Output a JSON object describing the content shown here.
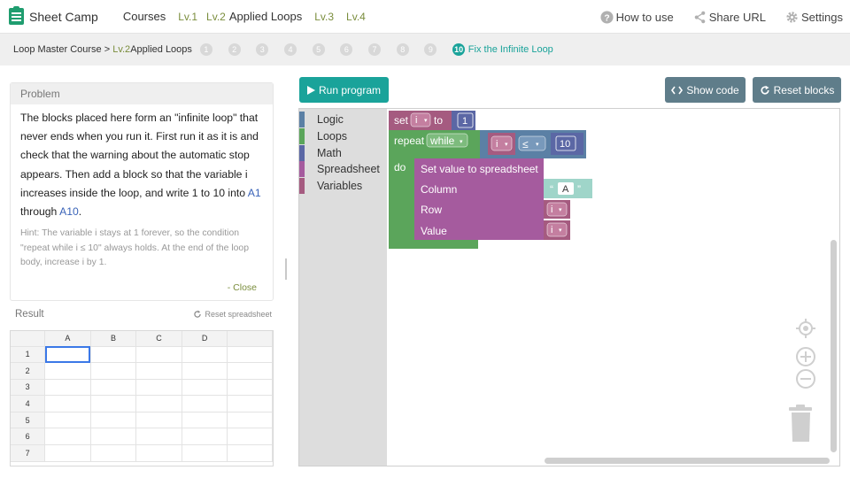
{
  "header": {
    "app_name": "Sheet Camp",
    "nav": {
      "courses": "Courses",
      "lv1": "Lv.1",
      "lv2": "Lv.2",
      "applied_loops": "Applied Loops",
      "lv3": "Lv.3",
      "lv4": "Lv.4"
    },
    "how_to_use": "How to use",
    "share_url": "Share URL",
    "settings": "Settings"
  },
  "breadcrumb": {
    "course": "Loop Master Course > ",
    "level": "Lv.2",
    "level_name": "Applied Loops",
    "steps": [
      "1",
      "2",
      "3",
      "4",
      "5",
      "6",
      "7",
      "8",
      "9"
    ],
    "current_step": "10",
    "current_step_label": "Fix the Infinite Loop"
  },
  "problem": {
    "heading": "Problem",
    "text_1": "The blocks placed here form an \"infinite loop\" that never ends when you run it. First run it as it is and check that the warning about the automatic stop appears. Then add a block so that the variable i increases inside the loop, and write 1 to 10 into ",
    "cell_a1": "A1",
    "text_2": " through ",
    "cell_a10": "A10",
    "text_3": ".",
    "hint": "Hint: The variable i stays at 1 forever, so the condition \"repeat while i ≤ 10\" always holds. At the end of the loop body, increase i by 1.",
    "close": "- Close"
  },
  "result": {
    "title": "Result",
    "reset_spreadsheet": "Reset spreadsheet",
    "columns": [
      "A",
      "B",
      "C",
      "D"
    ],
    "rows": [
      "1",
      "2",
      "3",
      "4",
      "5",
      "6",
      "7"
    ]
  },
  "toolbar": {
    "run_program": "Run program",
    "show_code": "Show code",
    "reset_blocks": "Reset blocks"
  },
  "toolbox": {
    "categories": [
      {
        "label": "Logic",
        "color": "#5b80a5"
      },
      {
        "label": "Loops",
        "color": "#5ba55b"
      },
      {
        "label": "Math",
        "color": "#5b67a5"
      },
      {
        "label": "Spreadsheet",
        "color": "#a55b9e"
      },
      {
        "label": "Variables",
        "color": "#a55b80"
      }
    ]
  },
  "blocks": {
    "set": "set",
    "var_i": "i",
    "to": "to",
    "init_value": "1",
    "repeat": "repeat",
    "while": "while",
    "compare_op": "≤",
    "limit": "10",
    "do": "do",
    "set_spreadsheet": "Set value to spreadsheet",
    "column": "Column",
    "column_value": "A",
    "row": "Row",
    "value": "Value",
    "colors": {
      "variable": "#a55b80",
      "loop": "#5ba55b",
      "logic": "#5b80a5",
      "math": "#5b67a5",
      "spreadsheet": "#a55b9e",
      "text": "#9fd5c9"
    }
  },
  "icons": {
    "logo": "sheet-logo-icon",
    "help": "question-circle-icon",
    "share": "share-icon",
    "settings": "gear-icon",
    "play": "play-icon",
    "code": "code-brackets-icon",
    "reset": "refresh-icon",
    "recenter": "crosshair-icon",
    "zoom_in": "zoom-in-icon",
    "zoom_out": "zoom-out-icon",
    "trash": "trash-icon"
  }
}
